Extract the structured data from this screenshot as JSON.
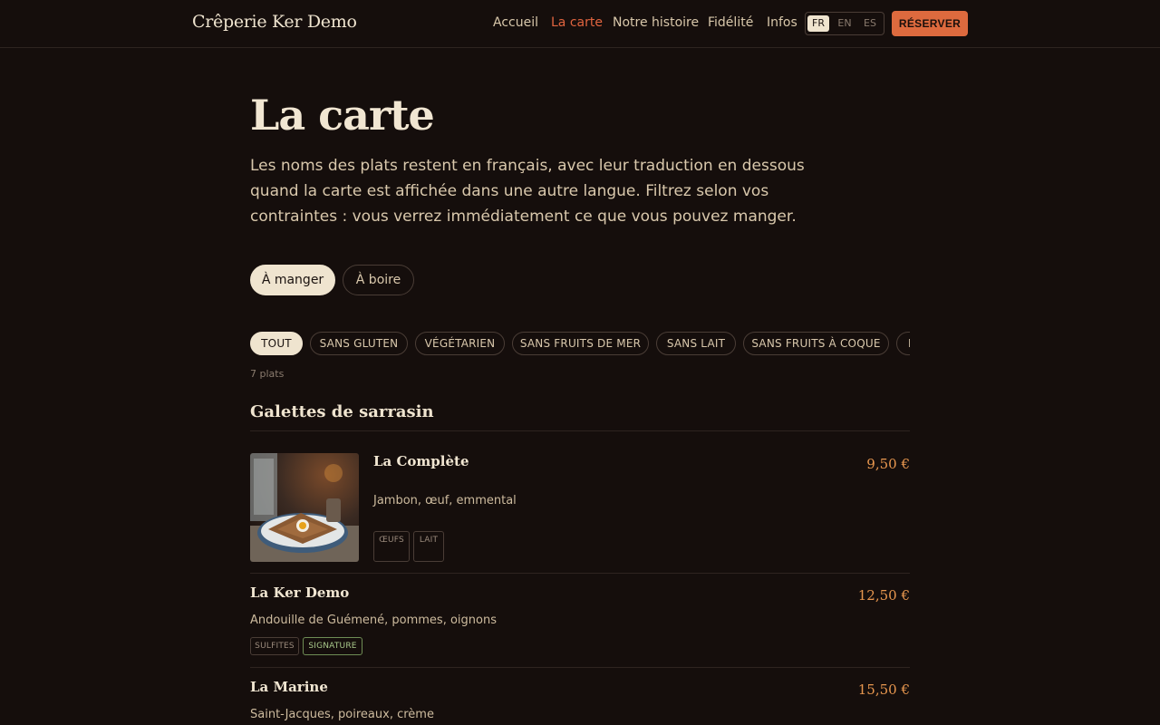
{
  "header": {
    "logo": "Crêperie Ker Demo",
    "nav": [
      "Accueil",
      "La carte",
      "Notre histoire",
      "Fidélité",
      "Infos"
    ],
    "languages": [
      "FR",
      "EN",
      "ES"
    ],
    "reserve_label": "RÉSERVER"
  },
  "hero": {
    "title": "La carte",
    "intro": "Les noms des plats restent en français, avec leur traduction en dessous quand la carte est affichée dans une autre langue. Filtrez selon vos contraintes : vous verrez immédiatement ce que vous pouvez manger."
  },
  "tabs": [
    "À manger",
    "À boire"
  ],
  "filters": [
    "TOUT",
    "SANS GLUTEN",
    "VÉGÉTARIEN",
    "SANS FRUITS DE MER",
    "SANS LAIT",
    "SANS FRUITS À COQUE",
    "I"
  ],
  "count": "7 plats",
  "section": {
    "title": "Galettes de sarrasin",
    "dishes": [
      {
        "name": "La Complète",
        "price": "9,50 €",
        "desc": "Jambon, œuf, emmental",
        "tags": [
          "ŒUFS",
          "LAIT"
        ]
      },
      {
        "name": "La Ker Demo",
        "price": "12,50 €",
        "desc": "Andouille de Guémené, pommes, oignons",
        "tags": [
          "SULFITES",
          "SIGNATURE"
        ]
      },
      {
        "name": "La Marine",
        "price": "15,50 €",
        "desc": "Saint-Jacques, poireaux, crème",
        "tags": []
      }
    ]
  },
  "colors": {
    "background": "#150e0c",
    "accent": "#dd6a3e",
    "price": "#e8974f",
    "signature": "#a9c98b"
  }
}
